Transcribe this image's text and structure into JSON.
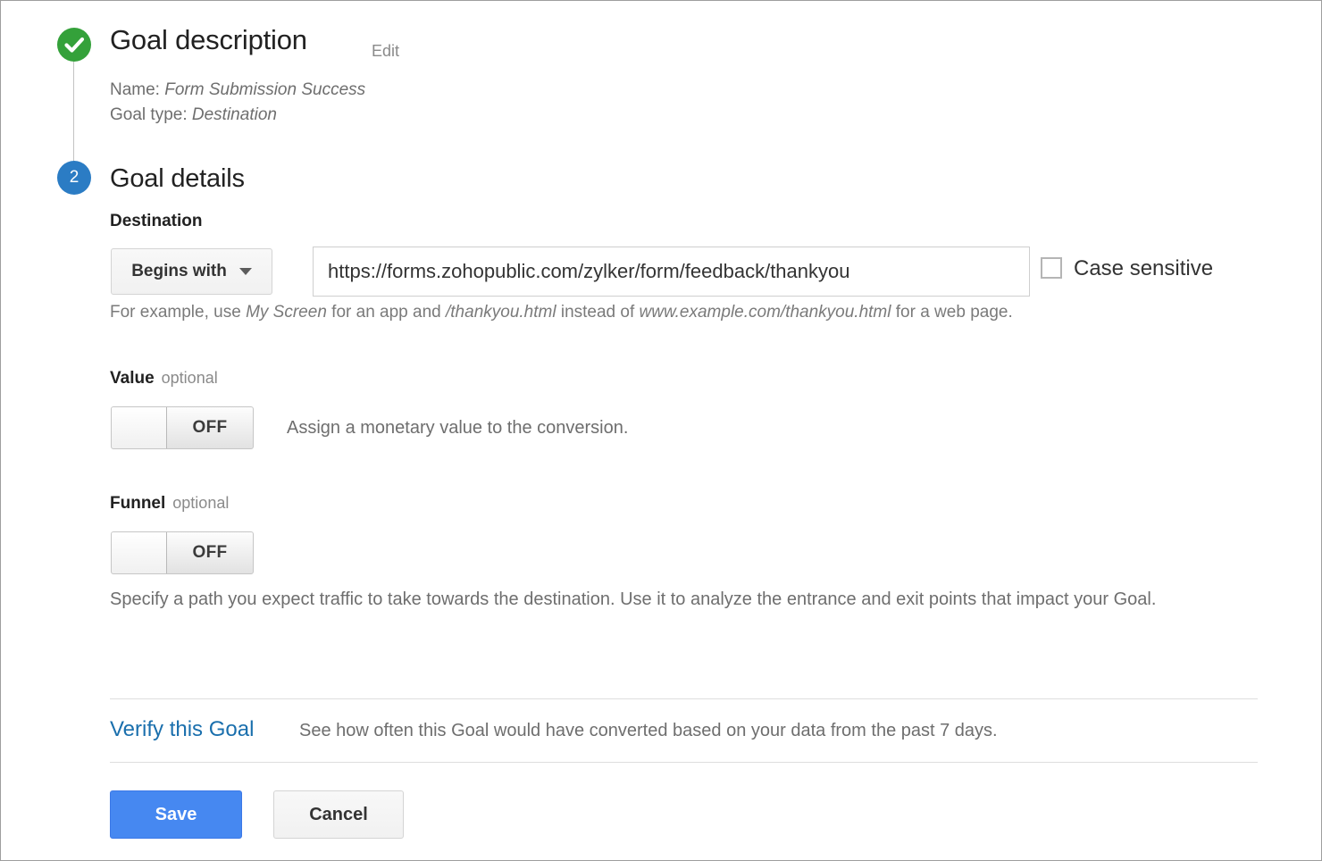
{
  "steps": {
    "description": {
      "status_icon": "check-circle-icon",
      "title": "Goal description",
      "edit_label": "Edit",
      "name_prefix": "Name:",
      "name_value": "Form Submission Success",
      "type_prefix": "Goal type:",
      "type_value": "Destination",
      "icon_color": "#34a13a"
    },
    "details": {
      "number": "2",
      "title": "Goal details",
      "icon_color": "#2b7cc4"
    }
  },
  "destination": {
    "label": "Destination",
    "match_type": "Begins with",
    "match_caret_icon": "chevron-down-icon",
    "url_value": "https://forms.zohopublic.com/zylker/form/feedback/thankyou",
    "case_sensitive_label": "Case sensitive",
    "case_sensitive_checked": false,
    "hint_pre": "For example, use ",
    "hint_em1": "My Screen",
    "hint_mid1": " for an app and ",
    "hint_em2": "/thankyou.html",
    "hint_mid2": " instead of ",
    "hint_em3": "www.example.com/thankyou.html",
    "hint_post": " for a web page."
  },
  "value": {
    "label": "Value",
    "optional": "optional",
    "toggle_state": "OFF",
    "description": "Assign a monetary value to the conversion."
  },
  "funnel": {
    "label": "Funnel",
    "optional": "optional",
    "toggle_state": "OFF",
    "description": "Specify a path you expect traffic to take towards the destination. Use it to analyze the entrance and exit points that impact your Goal."
  },
  "verify": {
    "link_label": "Verify this Goal",
    "description": "See how often this Goal would have converted based on your data from the past 7 days.",
    "link_color": "#1a6fad"
  },
  "footer": {
    "save_label": "Save",
    "cancel_label": "Cancel",
    "save_color": "#4688f1"
  }
}
